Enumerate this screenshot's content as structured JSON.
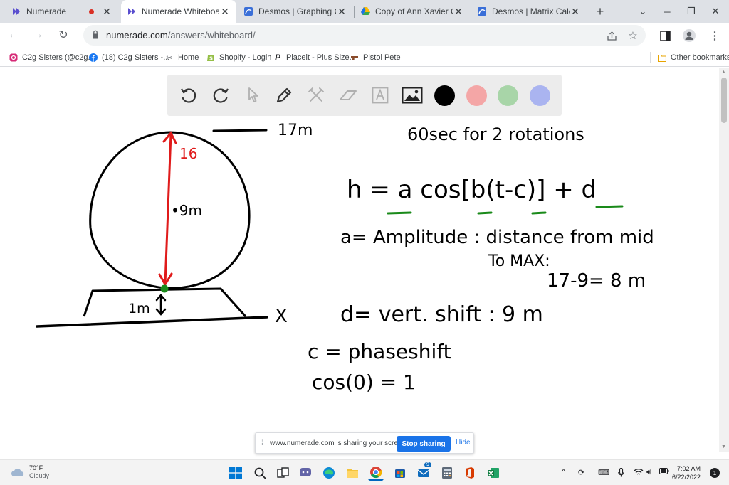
{
  "browser": {
    "tabs": [
      {
        "title": "Numerade",
        "active": false,
        "recording": true
      },
      {
        "title": "Numerade Whiteboard",
        "active": true
      },
      {
        "title": "Desmos | Graphing Calcul",
        "active": false
      },
      {
        "title": "Copy of Ann Xavier Gante",
        "active": false
      },
      {
        "title": "Desmos | Matrix Calculator",
        "active": false
      }
    ],
    "new_tab_label": "+",
    "url_host": "numerade.com",
    "url_path": "/answers/whiteboard/"
  },
  "bookmarks": [
    {
      "label": "C2g Sisters (@c2g...",
      "icon": "instagram-icon"
    },
    {
      "label": "(18) C2g Sisters -...",
      "icon": "facebook-icon"
    },
    {
      "label": "Home",
      "icon": "scissors-icon"
    },
    {
      "label": "Shopify - Login",
      "icon": "shopify-icon"
    },
    {
      "label": "Placeit - Plus Size...",
      "icon": "placeit-icon"
    },
    {
      "label": "Pistol Pete",
      "icon": "pistol-icon"
    }
  ],
  "other_bookmarks": "Other bookmarks",
  "whiteboard": {
    "tools": [
      "undo-icon",
      "redo-icon",
      "select-icon",
      "pen-icon",
      "tools-icon",
      "eraser-icon",
      "text-icon",
      "image-icon"
    ],
    "colors": [
      "#000000",
      "#f4a6a6",
      "#a8d5a8",
      "#aab4f0"
    ],
    "handwriting": {
      "top_label": "17m",
      "radius_label": "16",
      "center_label": "•9m",
      "base_label": "1m",
      "axis_label": "X",
      "period": "60sec for 2 rotations",
      "equation": "h = a cos[b(t-c)] + d",
      "amp_line1": "a= Amplitude : distance from mid",
      "amp_line2": "To MAX:",
      "amp_line3": "17-9= 8 m",
      "vert_shift": "d= vert. shift : 9 m",
      "phase_shift": "c = phaseshift",
      "cos_zero": "cos(0) = 1"
    }
  },
  "share_banner": {
    "message": "www.numerade.com is sharing your screen.",
    "stop_label": "Stop sharing",
    "hide_label": "Hide"
  },
  "taskbar": {
    "weather_temp": "70°F",
    "weather_desc": "Cloudy",
    "time": "7:02 AM",
    "date": "6/22/2022",
    "notifications": "1"
  }
}
